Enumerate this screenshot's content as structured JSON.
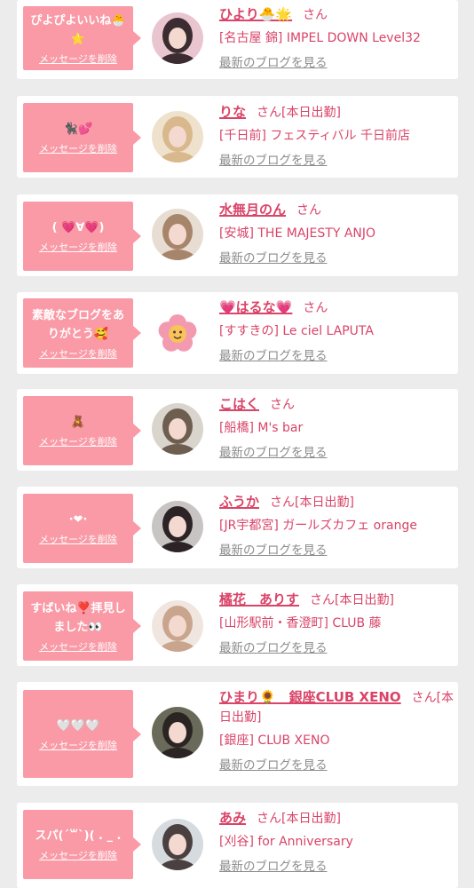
{
  "colors": {
    "accent": "#d94468",
    "bubble": "#f99aa6",
    "card": "#ffffff",
    "page_bg": "#ececec",
    "link_gray": "#8c8c8c"
  },
  "labels": {
    "delete": "メッセージを削除",
    "san": "さん",
    "blog": "最新のブログを見る"
  },
  "entries": [
    {
      "message": "ぴよぴよいいね🐣⭐",
      "name": "ひより🐣🌟",
      "today": "",
      "shop": "[名古屋 錦] IMPEL DOWN Level32",
      "avatar_icon": "photo-avatar-icon"
    },
    {
      "message": "🐈‍⬛💕",
      "name": "りな",
      "today": "[本日出勤]",
      "shop": "[千日前] フェスティバル 千日前店",
      "avatar_icon": "photo-avatar-icon"
    },
    {
      "message": "( 💗∀💗)",
      "name": "水無月のん",
      "today": "",
      "shop": "[安城] THE MAJESTY ANJO",
      "avatar_icon": "photo-avatar-icon"
    },
    {
      "message": "素敵なブログをありがとう🥰",
      "name": "💗はるな💗",
      "today": "",
      "shop": "[すすきの] Le ciel LAPUTA",
      "avatar_icon": "flower-avatar-icon"
    },
    {
      "message": "🧸",
      "name": "こはく",
      "today": "",
      "shop": "[船橋] M's bar",
      "avatar_icon": "photo-avatar-icon"
    },
    {
      "message": "·❤·",
      "name": "ふうか",
      "today": "[本日出勤]",
      "shop": "[JR宇都宮] ガールズカフェ orange",
      "avatar_icon": "photo-avatar-icon"
    },
    {
      "message": "すばいね❣️拝見しました👀",
      "name": "橘花　ありす",
      "today": "[本日出勤]",
      "shop": "[山形駅前・香澄町] CLUB 藤",
      "avatar_icon": "photo-avatar-icon"
    },
    {
      "message": "🤍🤍🤍",
      "name": "ひまり🌻　銀座CLUB XENO",
      "today": "[本日出勤]",
      "shop": "[銀座] CLUB XENO",
      "avatar_icon": "photo-avatar-icon"
    },
    {
      "message": "スパ(ˊ꒳ˋ)( . _ .",
      "name": "あみ",
      "today": "[本日出勤]",
      "shop": "[刈谷] for Anniversary",
      "avatar_icon": "photo-avatar-icon"
    }
  ]
}
